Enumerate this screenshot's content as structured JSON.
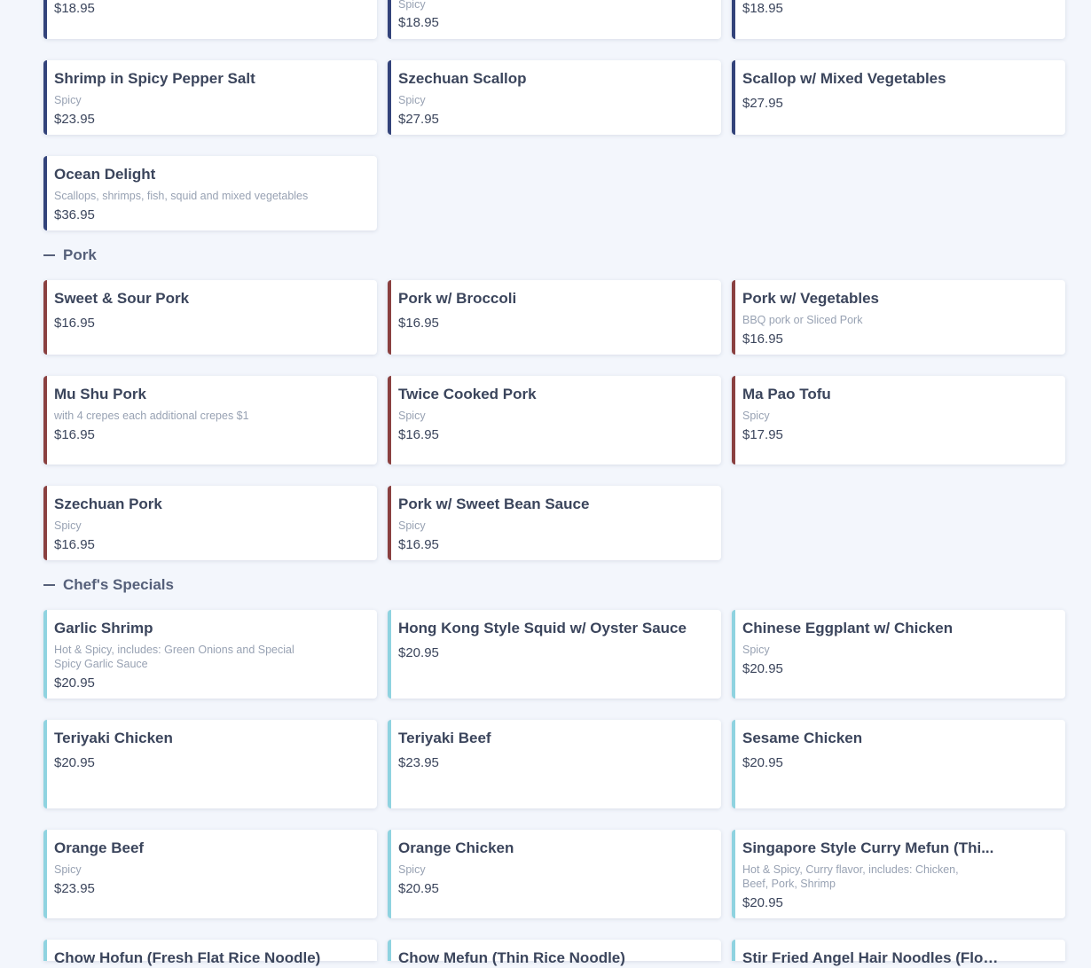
{
  "seafood_partial": {
    "r0c0": {
      "price": "$18.95"
    },
    "r0c1": {
      "desc": "Spicy",
      "price": "$18.95"
    },
    "r0c2": {
      "price": "$18.95"
    },
    "r1c0": {
      "name": "Shrimp in Spicy Pepper Salt",
      "desc": "Spicy",
      "price": "$23.95"
    },
    "r1c1": {
      "name": "Szechuan Scallop",
      "desc": "Spicy",
      "price": "$27.95"
    },
    "r1c2": {
      "name": "Scallop w/ Mixed Vegetables",
      "price": "$27.95"
    },
    "r2c0": {
      "name": "Ocean Delight",
      "desc": "Scallops, shrimps, fish, squid and mixed vegetables",
      "price": "$36.95"
    }
  },
  "pork": {
    "title": "Pork",
    "items": [
      {
        "name": "Sweet & Sour Pork",
        "price": "$16.95"
      },
      {
        "name": "Pork w/ Broccoli",
        "price": "$16.95"
      },
      {
        "name": "Pork w/ Vegetables",
        "desc": "BBQ pork or Sliced Pork",
        "price": "$16.95"
      },
      {
        "name": "Mu Shu Pork",
        "desc": "with 4 crepes each additional crepes $1",
        "price": "$16.95"
      },
      {
        "name": "Twice Cooked Pork",
        "desc": "Spicy",
        "price": "$16.95"
      },
      {
        "name": "Ma Pao Tofu",
        "desc": "Spicy",
        "price": "$17.95"
      },
      {
        "name": "Szechuan Pork",
        "desc": "Spicy",
        "price": "$16.95"
      },
      {
        "name": "Pork w/ Sweet Bean Sauce",
        "desc": "Spicy",
        "price": "$16.95"
      }
    ]
  },
  "chefs": {
    "title": "Chef's Specials",
    "items": [
      {
        "name": "Garlic Shrimp",
        "desc": "Hot & Spicy, includes: Green Onions and Special Spicy Garlic Sauce",
        "price": "$20.95"
      },
      {
        "name": "Hong Kong Style Squid w/ Oyster Sauce",
        "price": "$20.95"
      },
      {
        "name": "Chinese Eggplant w/ Chicken",
        "desc": "Spicy",
        "price": "$20.95"
      },
      {
        "name": "Teriyaki Chicken",
        "price": "$20.95"
      },
      {
        "name": "Teriyaki Beef",
        "price": "$23.95"
      },
      {
        "name": "Sesame Chicken",
        "price": "$20.95"
      },
      {
        "name": "Orange Beef",
        "desc": "Spicy",
        "price": "$23.95"
      },
      {
        "name": "Orange Chicken",
        "desc": "Spicy",
        "price": "$20.95"
      },
      {
        "name": "Singapore Style Curry Mefun (Thi...",
        "desc": "Hot & Spicy, Curry flavor, includes: Chicken, Beef, Pork, Shrimp",
        "price": "$20.95"
      },
      {
        "name": "Chow Hofun (Fresh Flat Rice Noodle)"
      },
      {
        "name": "Chow Mefun (Thin Rice Noodle)"
      },
      {
        "name": "Stir Fried Angel Hair Noodles (Flou..."
      }
    ]
  },
  "colors": {
    "seafood_accent": "#33437a",
    "pork_accent": "#8a4040",
    "chef_accent": "#8fd3e0",
    "background": "#f3f6fc"
  }
}
